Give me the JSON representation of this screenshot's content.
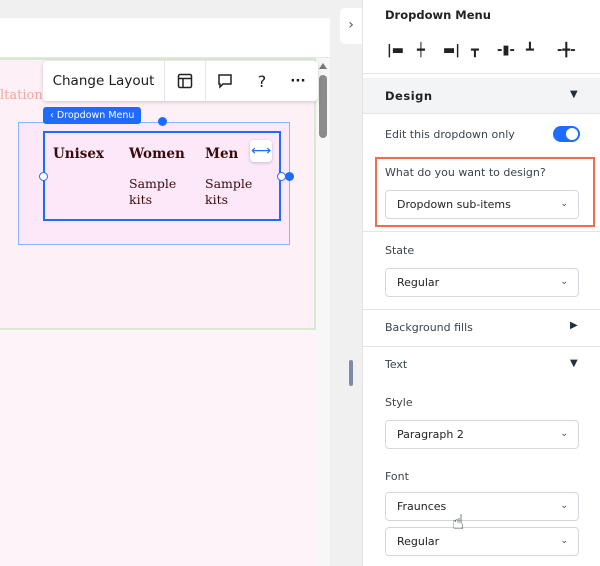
{
  "canvas": {
    "faded_text": "ltations",
    "badge": "Dropdown Menu",
    "menu": [
      {
        "label": "Unisex",
        "sub": ""
      },
      {
        "label": "Women",
        "sub": "Sample kits"
      },
      {
        "label": "Men",
        "sub": "Sample kits"
      }
    ]
  },
  "toolbar": {
    "change_layout": "Change Layout",
    "help": "?",
    "more": "···"
  },
  "panel": {
    "title": "Dropdown Menu",
    "design": "Design",
    "edit_only": "Edit this dropdown only",
    "edit_only_on": true,
    "what_design_label": "What do you want to design?",
    "what_design_value": "Dropdown sub-items",
    "state_label": "State",
    "state_value": "Regular",
    "background_fills": "Background fills",
    "text": "Text",
    "style_label": "Style",
    "style_value": "Paragraph 2",
    "font_label": "Font",
    "font_value": "Fraunces",
    "font_weight_value": "Regular"
  },
  "colors": {
    "accent": "#1f6bff",
    "highlight": "#f26b4f"
  }
}
